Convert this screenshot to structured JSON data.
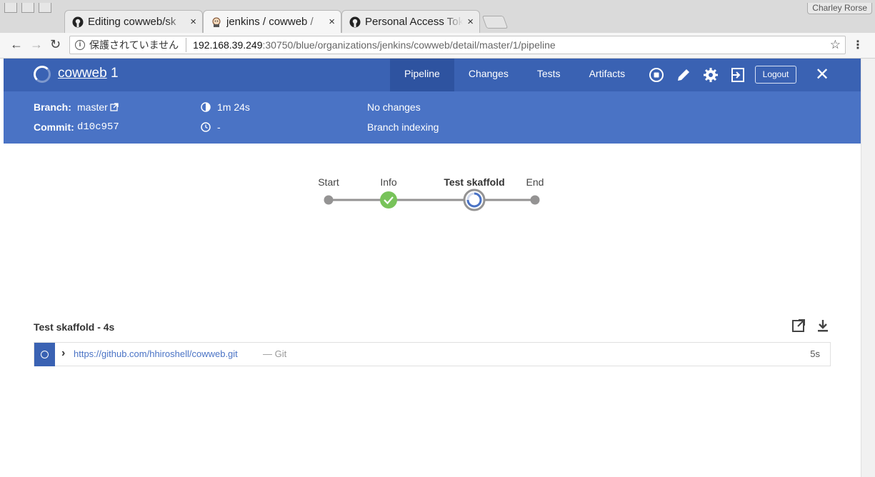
{
  "browser": {
    "user_badge": "Charley Rorse",
    "tabs": [
      {
        "title": "Editing cowweb/sk",
        "close": "×"
      },
      {
        "title": "jenkins / cowweb / ",
        "close": "×"
      },
      {
        "title": "Personal Access Tok",
        "close": "×"
      }
    ],
    "security_warning": "保護されていません",
    "url_host": "192.168.39.249",
    "url_path": ":30750/blue/organizations/jenkins/cowweb/detail/master/1/pipeline"
  },
  "run": {
    "pipeline_name": "cowweb",
    "run_number": "1",
    "nav": [
      "Pipeline",
      "Changes",
      "Tests",
      "Artifacts"
    ],
    "logout_label": "Logout",
    "branch_label": "Branch:",
    "branch_value": "master",
    "commit_label": "Commit:",
    "commit_value": "d10c957",
    "duration": "1m 24s",
    "ended": "-",
    "changes": "No changes",
    "cause": "Branch indexing"
  },
  "graph": {
    "stages": [
      {
        "label": "Start",
        "state": "node"
      },
      {
        "label": "Info",
        "state": "success"
      },
      {
        "label": "Test skaffold",
        "state": "running"
      },
      {
        "label": "End",
        "state": "node"
      }
    ]
  },
  "step": {
    "title": "Test skaffold - 4s",
    "link": "https://github.com/hhiroshell/cowweb.git",
    "suffix": "— Git",
    "duration": "5s"
  },
  "colors": {
    "header_dark": "#3a62b3",
    "header_light": "#4a73c5",
    "success": "#78c35a",
    "running": "#4a73c5"
  }
}
